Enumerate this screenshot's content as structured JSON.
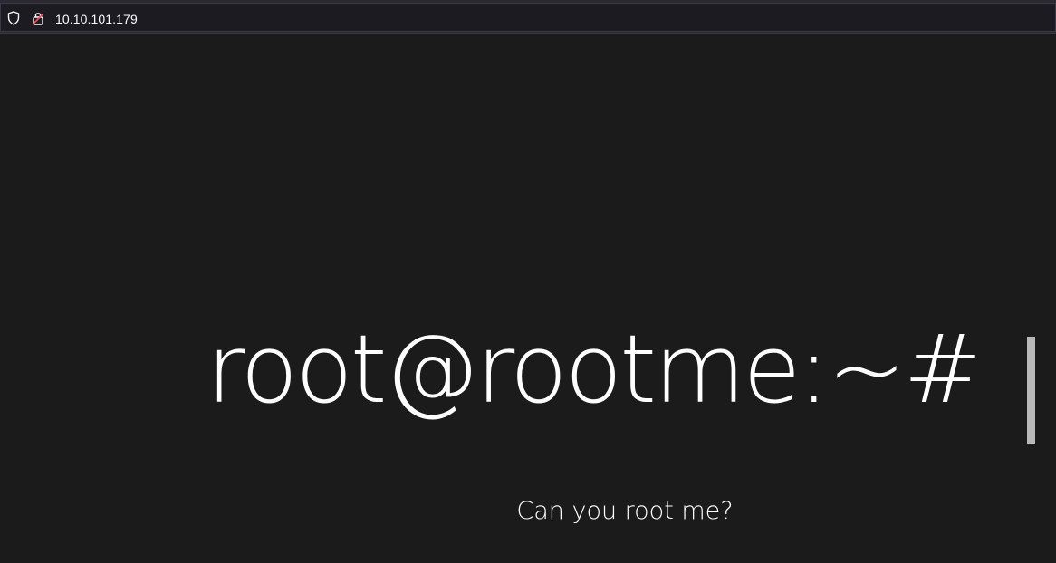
{
  "browser": {
    "url": "10.10.101.179",
    "icons": [
      "shield-icon",
      "insecure-lock-icon"
    ]
  },
  "page": {
    "prompt": "root@rootme:~#",
    "subtitle": "Can you root me?",
    "colors": {
      "background": "#1b1b1b",
      "text": "#ffffff",
      "cursor": "#b9b9b9"
    }
  }
}
